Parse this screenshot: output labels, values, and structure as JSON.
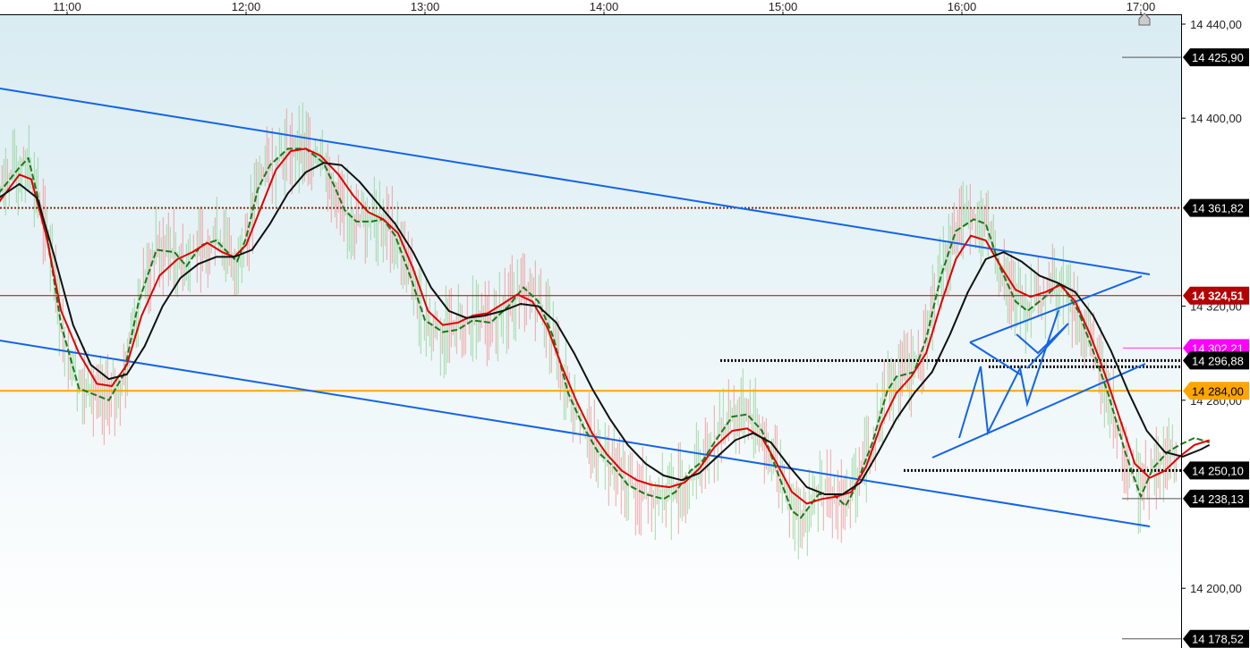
{
  "chart_data": {
    "type": "line",
    "title": "",
    "xlabel": "",
    "ylabel": "",
    "x_ticks": [
      "11:00",
      "12:00",
      "13:00",
      "14:00",
      "15:00",
      "16:00",
      "17:00"
    ],
    "y_ticks": [
      "14 440,00",
      "14 400,00",
      "14 320,00",
      "14 280,00",
      "14 200,00"
    ],
    "ylim": [
      14176,
      14444
    ],
    "xlim": [
      "10:37",
      "17:23"
    ],
    "grid": false,
    "price_levels": [
      {
        "label": "14 425,90",
        "value": 14425.9,
        "style": "marker",
        "color": "#000000",
        "text_color": "#ffffff"
      },
      {
        "label": "14 361,82",
        "value": 14361.82,
        "style": "dotted-line",
        "color": "#000000",
        "line_color": "#8b2a10",
        "text_color": "#ffffff"
      },
      {
        "label": "14 324,51",
        "value": 14324.51,
        "style": "solid-line",
        "color": "#b30000",
        "line_color": "#b30000",
        "text_color": "#ffffff"
      },
      {
        "label": "14 302,21",
        "value": 14302.21,
        "style": "short-line",
        "color": "#ff00ff",
        "line_color": "#ff33ff",
        "text_color": "#ffffff"
      },
      {
        "label": "14 296,88",
        "value": 14296.88,
        "style": "dotted-line",
        "color": "#000000",
        "line_color": "#000000",
        "text_color": "#ffffff"
      },
      {
        "label": "14 284,00",
        "value": 14284.0,
        "style": "solid-line",
        "color": "#ffa500",
        "line_color": "#ffa500",
        "text_color": "#000000"
      },
      {
        "label": "14 250,10",
        "value": 14250.1,
        "style": "dotted-line",
        "color": "#000000",
        "line_color": "#000000",
        "text_color": "#ffffff"
      },
      {
        "label": "14 238,13",
        "value": 14238.13,
        "style": "marker",
        "color": "#000000",
        "text_color": "#ffffff"
      },
      {
        "label": "14 178,52",
        "value": 14178.52,
        "style": "marker",
        "color": "#000000",
        "text_color": "#ffffff"
      }
    ],
    "series": [
      {
        "color": "#1a7a1a",
        "style": "dashed",
        "points": [
          [
            "10:37",
            14368
          ],
          [
            "10:44",
            14379
          ],
          [
            "10:47",
            14383
          ],
          [
            "10:53",
            14352
          ],
          [
            "10:58",
            14312
          ],
          [
            "11:04",
            14285
          ],
          [
            "11:08",
            14283
          ],
          [
            "11:14",
            14280
          ],
          [
            "11:19",
            14291
          ],
          [
            "11:24",
            14322
          ],
          [
            "11:30",
            14344
          ],
          [
            "11:36",
            14343
          ],
          [
            "11:40",
            14337
          ],
          [
            "11:45",
            14346
          ],
          [
            "11:50",
            14348
          ],
          [
            "11:53",
            14344
          ],
          [
            "11:57",
            14339
          ],
          [
            "12:00",
            14349
          ],
          [
            "12:04",
            14370
          ],
          [
            "12:08",
            14380
          ],
          [
            "12:14",
            14387
          ],
          [
            "12:20",
            14387
          ],
          [
            "12:26",
            14381
          ],
          [
            "12:30",
            14370
          ],
          [
            "12:33",
            14361
          ],
          [
            "12:37",
            14356
          ],
          [
            "12:42",
            14356
          ],
          [
            "12:46",
            14357
          ],
          [
            "12:50",
            14350
          ],
          [
            "12:55",
            14333
          ],
          [
            "13:00",
            14314
          ],
          [
            "13:06",
            14309
          ],
          [
            "13:11",
            14310
          ],
          [
            "13:16",
            14314
          ],
          [
            "13:22",
            14313
          ],
          [
            "13:28",
            14320
          ],
          [
            "13:33",
            14328
          ],
          [
            "13:38",
            14322
          ],
          [
            "13:43",
            14307
          ],
          [
            "13:48",
            14283
          ],
          [
            "13:53",
            14269
          ],
          [
            "13:58",
            14258
          ],
          [
            "14:03",
            14252
          ],
          [
            "14:08",
            14244
          ],
          [
            "14:14",
            14240
          ],
          [
            "14:20",
            14238
          ],
          [
            "14:24",
            14241
          ],
          [
            "14:29",
            14250
          ],
          [
            "14:33",
            14254
          ],
          [
            "14:37",
            14262
          ],
          [
            "14:43",
            14273
          ],
          [
            "14:48",
            14274
          ],
          [
            "14:53",
            14267
          ],
          [
            "14:58",
            14250
          ],
          [
            "15:03",
            14233
          ],
          [
            "15:06",
            14230
          ],
          [
            "15:12",
            14240
          ],
          [
            "15:17",
            14240
          ],
          [
            "15:21",
            14235
          ],
          [
            "15:24",
            14242
          ],
          [
            "15:30",
            14262
          ],
          [
            "15:35",
            14284
          ],
          [
            "15:38",
            14290
          ],
          [
            "15:44",
            14292
          ],
          [
            "15:48",
            14306
          ],
          [
            "15:53",
            14333
          ],
          [
            "15:58",
            14352
          ],
          [
            "16:04",
            14357
          ],
          [
            "16:08",
            14355
          ],
          [
            "16:13",
            14336
          ],
          [
            "16:18",
            14322
          ],
          [
            "16:22",
            14318
          ],
          [
            "16:27",
            14323
          ],
          [
            "16:33",
            14330
          ],
          [
            "16:39",
            14318
          ],
          [
            "16:44",
            14301
          ],
          [
            "16:49",
            14283
          ],
          [
            "16:55",
            14257
          ],
          [
            "17:00",
            14239
          ],
          [
            "17:04",
            14251
          ],
          [
            "17:09",
            14258
          ],
          [
            "17:13",
            14261
          ],
          [
            "17:18",
            14264
          ],
          [
            "17:23",
            14262
          ]
        ]
      },
      {
        "color": "#e00000",
        "style": "solid",
        "points": [
          [
            "10:37",
            14364
          ],
          [
            "10:44",
            14376
          ],
          [
            "10:48",
            14374
          ],
          [
            "10:53",
            14350
          ],
          [
            "10:58",
            14318
          ],
          [
            "11:04",
            14300
          ],
          [
            "11:10",
            14287
          ],
          [
            "11:15",
            14286
          ],
          [
            "11:20",
            14295
          ],
          [
            "11:25",
            14316
          ],
          [
            "11:31",
            14333
          ],
          [
            "11:37",
            14340
          ],
          [
            "11:42",
            14343
          ],
          [
            "11:47",
            14347
          ],
          [
            "11:52",
            14343
          ],
          [
            "11:56",
            14341
          ],
          [
            "12:00",
            14346
          ],
          [
            "12:05",
            14362
          ],
          [
            "12:10",
            14378
          ],
          [
            "12:15",
            14386
          ],
          [
            "12:20",
            14387
          ],
          [
            "12:25",
            14384
          ],
          [
            "12:31",
            14376
          ],
          [
            "12:36",
            14367
          ],
          [
            "12:41",
            14360
          ],
          [
            "12:46",
            14357
          ],
          [
            "12:51",
            14351
          ],
          [
            "12:56",
            14336
          ],
          [
            "13:01",
            14318
          ],
          [
            "13:06",
            14312
          ],
          [
            "13:11",
            14313
          ],
          [
            "13:16",
            14316
          ],
          [
            "13:21",
            14317
          ],
          [
            "13:26",
            14321
          ],
          [
            "13:31",
            14325
          ],
          [
            "13:36",
            14322
          ],
          [
            "13:41",
            14311
          ],
          [
            "13:46",
            14294
          ],
          [
            "13:51",
            14279
          ],
          [
            "13:56",
            14266
          ],
          [
            "14:01",
            14257
          ],
          [
            "14:06",
            14250
          ],
          [
            "14:11",
            14246
          ],
          [
            "14:16",
            14244
          ],
          [
            "14:22",
            14243
          ],
          [
            "14:27",
            14245
          ],
          [
            "14:32",
            14251
          ],
          [
            "14:37",
            14260
          ],
          [
            "14:43",
            14267
          ],
          [
            "14:48",
            14268
          ],
          [
            "14:53",
            14264
          ],
          [
            "14:58",
            14253
          ],
          [
            "15:03",
            14241
          ],
          [
            "15:08",
            14236
          ],
          [
            "15:13",
            14238
          ],
          [
            "15:18",
            14239
          ],
          [
            "15:23",
            14241
          ],
          [
            "15:28",
            14252
          ],
          [
            "15:33",
            14270
          ],
          [
            "15:38",
            14283
          ],
          [
            "15:43",
            14290
          ],
          [
            "15:48",
            14300
          ],
          [
            "15:53",
            14321
          ],
          [
            "15:58",
            14340
          ],
          [
            "16:03",
            14350
          ],
          [
            "16:08",
            14348
          ],
          [
            "16:13",
            14337
          ],
          [
            "16:18",
            14327
          ],
          [
            "16:23",
            14324
          ],
          [
            "16:28",
            14326
          ],
          [
            "16:33",
            14329
          ],
          [
            "16:38",
            14322
          ],
          [
            "16:43",
            14308
          ],
          [
            "16:48",
            14291
          ],
          [
            "16:53",
            14272
          ],
          [
            "16:58",
            14253
          ],
          [
            "17:03",
            14247
          ],
          [
            "17:08",
            14250
          ],
          [
            "17:13",
            14256
          ],
          [
            "17:18",
            14261
          ],
          [
            "17:23",
            14263
          ]
        ]
      },
      {
        "color": "#111111",
        "style": "solid",
        "points": [
          [
            "10:37",
            14366
          ],
          [
            "10:44",
            14372
          ],
          [
            "10:50",
            14366
          ],
          [
            "10:56",
            14340
          ],
          [
            "11:02",
            14312
          ],
          [
            "11:08",
            14295
          ],
          [
            "11:14",
            14289
          ],
          [
            "11:20",
            14291
          ],
          [
            "11:26",
            14303
          ],
          [
            "11:32",
            14320
          ],
          [
            "11:38",
            14332
          ],
          [
            "11:44",
            14338
          ],
          [
            "11:50",
            14341
          ],
          [
            "11:56",
            14341
          ],
          [
            "12:02",
            14344
          ],
          [
            "12:08",
            14355
          ],
          [
            "12:14",
            14368
          ],
          [
            "12:20",
            14377
          ],
          [
            "12:26",
            14381
          ],
          [
            "12:32",
            14380
          ],
          [
            "12:38",
            14373
          ],
          [
            "12:44",
            14364
          ],
          [
            "12:50",
            14355
          ],
          [
            "12:56",
            14343
          ],
          [
            "13:02",
            14328
          ],
          [
            "13:08",
            14318
          ],
          [
            "13:14",
            14315
          ],
          [
            "13:20",
            14316
          ],
          [
            "13:26",
            14318
          ],
          [
            "13:32",
            14321
          ],
          [
            "13:38",
            14320
          ],
          [
            "13:44",
            14313
          ],
          [
            "13:50",
            14300
          ],
          [
            "13:56",
            14285
          ],
          [
            "14:02",
            14272
          ],
          [
            "14:08",
            14261
          ],
          [
            "14:14",
            14253
          ],
          [
            "14:20",
            14248
          ],
          [
            "14:26",
            14246
          ],
          [
            "14:32",
            14249
          ],
          [
            "14:38",
            14256
          ],
          [
            "14:44",
            14263
          ],
          [
            "14:50",
            14266
          ],
          [
            "14:56",
            14262
          ],
          [
            "15:02",
            14252
          ],
          [
            "15:08",
            14243
          ],
          [
            "15:14",
            14240
          ],
          [
            "15:20",
            14240
          ],
          [
            "15:26",
            14245
          ],
          [
            "15:32",
            14258
          ],
          [
            "15:38",
            14272
          ],
          [
            "15:44",
            14283
          ],
          [
            "15:50",
            14292
          ],
          [
            "15:56",
            14308
          ],
          [
            "16:02",
            14326
          ],
          [
            "16:08",
            14340
          ],
          [
            "16:14",
            14343
          ],
          [
            "16:20",
            14339
          ],
          [
            "16:26",
            14333
          ],
          [
            "16:32",
            14330
          ],
          [
            "16:38",
            14326
          ],
          [
            "16:44",
            14316
          ],
          [
            "16:50",
            14301
          ],
          [
            "16:56",
            14283
          ],
          [
            "17:02",
            14267
          ],
          [
            "17:08",
            14258
          ],
          [
            "17:14",
            14256
          ],
          [
            "17:20",
            14259
          ],
          [
            "17:23",
            14261
          ]
        ]
      }
    ]
  }
}
